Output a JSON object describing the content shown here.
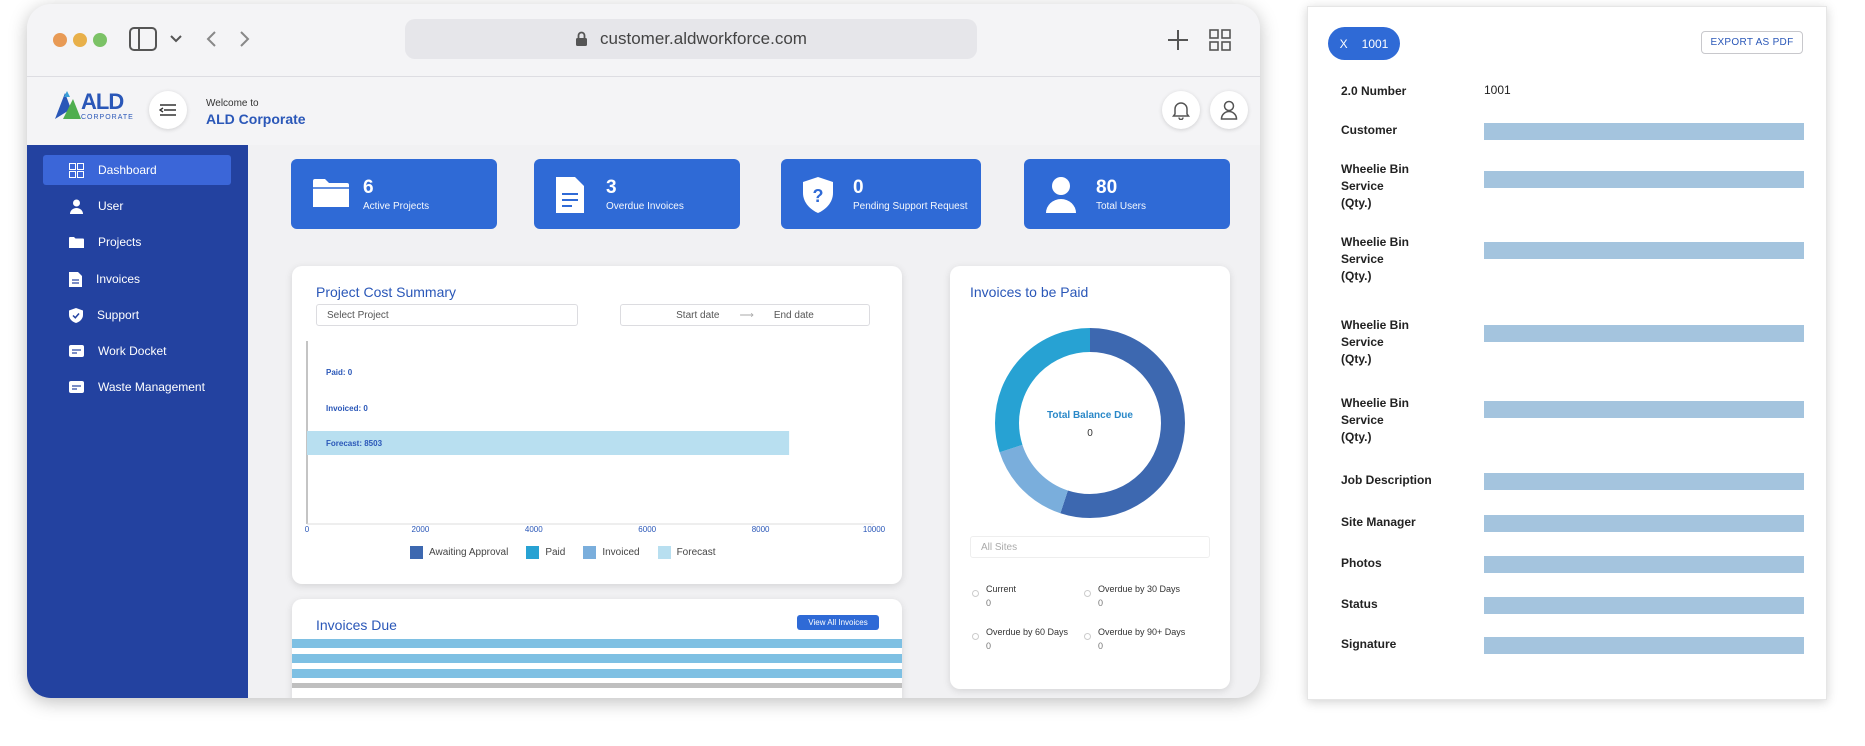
{
  "browser": {
    "url": "customer.aldworkforce.com",
    "traffic_light_colors": [
      "#e89a55",
      "#e8b04a",
      "#7bc266"
    ]
  },
  "app": {
    "logo_text": "ALD",
    "logo_subtext": "CORPORATE",
    "welcome_label": "Welcome to",
    "company_name": "ALD Corporate"
  },
  "sidebar": {
    "items": [
      {
        "label": "Dashboard",
        "icon": "grid-icon"
      },
      {
        "label": "User",
        "icon": "user-icon"
      },
      {
        "label": "Projects",
        "icon": "folder-icon"
      },
      {
        "label": "Invoices",
        "icon": "document-icon"
      },
      {
        "label": "Support",
        "icon": "shield-icon"
      },
      {
        "label": "Work Docket",
        "icon": "card-icon"
      },
      {
        "label": "Waste Management",
        "icon": "card-icon"
      }
    ]
  },
  "stats": [
    {
      "value": "6",
      "label": "Active Projects",
      "icon": "folder-icon"
    },
    {
      "value": "3",
      "label": "Overdue Invoices",
      "icon": "document-icon"
    },
    {
      "value": "0",
      "label": "Pending Support Request",
      "icon": "shield-question-icon"
    },
    {
      "value": "80",
      "label": "Total Users",
      "icon": "user-icon"
    }
  ],
  "project_cost": {
    "title": "Project Cost Summary",
    "select_placeholder": "Select Project",
    "start_date": "Start date",
    "date_arrow": "⟶",
    "end_date": "End date",
    "legend": [
      "Awaiting Approval",
      "Paid",
      "Invoiced",
      "Forecast"
    ]
  },
  "chart_data": {
    "type": "bar",
    "orientation": "horizontal",
    "categories": [
      "Paid",
      "Invoiced",
      "Forecast"
    ],
    "data_labels": [
      "Paid: 0",
      "Invoiced: 0",
      "Forecast: 8503"
    ],
    "values": [
      0,
      0,
      8503
    ],
    "xlim": [
      0,
      10000
    ],
    "x_ticks": [
      "0",
      "2000",
      "4000",
      "6000",
      "8000",
      "10000"
    ],
    "colors": {
      "awaiting": "#3d68b0",
      "paid": "#27a2d3",
      "invoiced": "#7aaedc",
      "forecast": "#b8dff0"
    }
  },
  "invoices_paid": {
    "title": "Invoices to be Paid",
    "center_label": "Total Balance Due",
    "center_value": "0",
    "sites_placeholder": "All Sites",
    "legend": [
      {
        "label": "Current",
        "value": "0"
      },
      {
        "label": "Overdue by 30 Days",
        "value": "0"
      },
      {
        "label": "Overdue by 60 Days",
        "value": "0"
      },
      {
        "label": "Overdue by 90+ Days",
        "value": "0"
      }
    ]
  },
  "invoices_due": {
    "title": "Invoices Due",
    "view_all": "View All Invoices"
  },
  "detail": {
    "pill_x": "X",
    "pill_id": "1001",
    "export": "EXPORT AS PDF",
    "number_label": "2.0 Number",
    "number_value": "1001",
    "fields": [
      "Customer",
      "Wheelie Bin\nService\n(Qty.)",
      "Wheelie Bin\nService\n(Qty.)",
      "Wheelie Bin\nService\n(Qty.)",
      "Wheelie Bin\nService\n(Qty.)",
      "Job Description",
      "Site Manager",
      "Photos",
      "Status",
      "Signature"
    ]
  }
}
